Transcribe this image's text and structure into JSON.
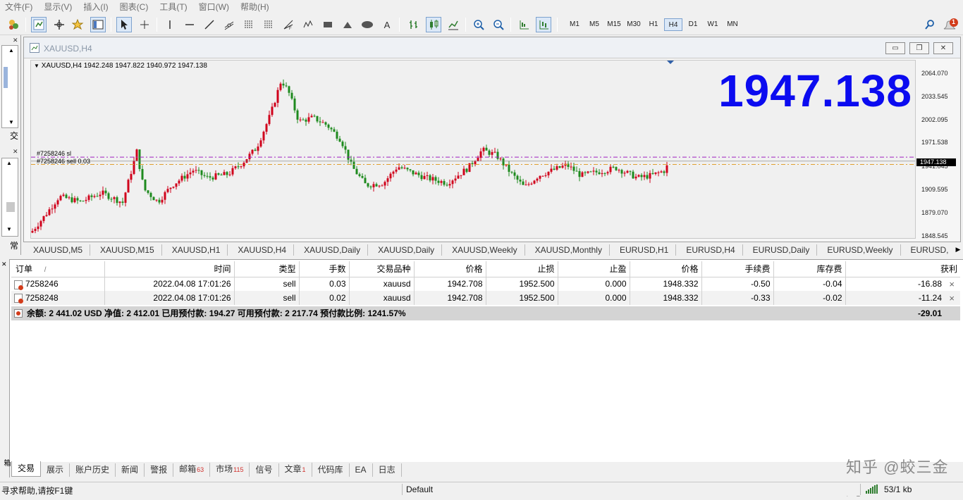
{
  "menu": [
    "文件(F)",
    "显示(V)",
    "插入(I)",
    "图表(C)",
    "工具(T)",
    "窗口(W)",
    "帮助(H)"
  ],
  "toolbar": {
    "timeframes": [
      "M1",
      "M5",
      "M15",
      "M30",
      "H1",
      "H4",
      "D1",
      "W1",
      "MN"
    ],
    "active_timeframe": "H4",
    "text_tool": "A",
    "notification_count": "1"
  },
  "left_panel": {
    "tab_label_1": "交",
    "tab_label_2": "常"
  },
  "chart": {
    "window_title": "XAUUSD,H4",
    "info_line": "XAUUSD,H4  1942.248 1947.822 1940.972 1947.138",
    "big_price": "1947.138",
    "sl_label": "#7258246 sl",
    "order_label": "#7258246 sell 0.03",
    "price_ticks": [
      "2064.070",
      "2033.545",
      "2002.095",
      "1971.538",
      "1941.045",
      "1909.595",
      "1879.070",
      "1848.545"
    ],
    "current_price_box": "1947.138",
    "candle_up_color": "#d0021b",
    "candle_down_color": "#1e8a1e",
    "sl_line_color": "#a020c0",
    "order_line_color": "#e0a030"
  },
  "symbol_tabs": [
    "XAUUSD,M5",
    "XAUUSD,M15",
    "XAUUSD,H1",
    "XAUUSD,H4",
    "XAUUSD,Daily",
    "XAUUSD,Daily",
    "XAUUSD,Weekly",
    "XAUUSD,Monthly",
    "EURUSD,H1",
    "EURUSD,H4",
    "EURUSD,Daily",
    "EURUSD,Weekly",
    "EURUSD,"
  ],
  "orders": {
    "headers": [
      "订单",
      "/",
      "时间",
      "类型",
      "手数",
      "交易品种",
      "价格",
      "止损",
      "止盈",
      "价格",
      "手续费",
      "库存费",
      "获利"
    ],
    "rows": [
      {
        "ticket": "7258246",
        "time": "2022.04.08 17:01:26",
        "type": "sell",
        "lots": "0.03",
        "symbol": "xauusd",
        "open_price": "1942.708",
        "sl": "1952.500",
        "tp": "0.000",
        "price": "1948.332",
        "commission": "-0.50",
        "swap": "-0.04",
        "profit": "-16.88"
      },
      {
        "ticket": "7258248",
        "time": "2022.04.08 17:01:26",
        "type": "sell",
        "lots": "0.02",
        "symbol": "xauusd",
        "open_price": "1942.708",
        "sl": "1952.500",
        "tp": "0.000",
        "price": "1948.332",
        "commission": "-0.33",
        "swap": "-0.02",
        "profit": "-11.24"
      }
    ],
    "close_glyph": "×",
    "summary": "余额: 2 441.02 USD  净值: 2 412.01  已用预付款: 194.27  可用预付款: 2 217.74  预付款比例: 1241.57%",
    "summary_total": "-29.01"
  },
  "terminal_tabs": [
    {
      "label": "交易",
      "badge": ""
    },
    {
      "label": "展示",
      "badge": ""
    },
    {
      "label": "账户历史",
      "badge": ""
    },
    {
      "label": "新闻",
      "badge": ""
    },
    {
      "label": "警报",
      "badge": ""
    },
    {
      "label": "邮箱",
      "badge": "63"
    },
    {
      "label": "市场",
      "badge": "115"
    },
    {
      "label": "信号",
      "badge": ""
    },
    {
      "label": "文章",
      "badge": "1"
    },
    {
      "label": "代码库",
      "badge": ""
    },
    {
      "label": "EA",
      "badge": ""
    },
    {
      "label": "日志",
      "badge": ""
    }
  ],
  "terminal_side_label": "工具箱",
  "watermark": "知乎 @蛟三金鹰",
  "status": {
    "help": "寻求帮助,请按F1键",
    "profile": "Default",
    "traffic": "53/1 kb"
  }
}
